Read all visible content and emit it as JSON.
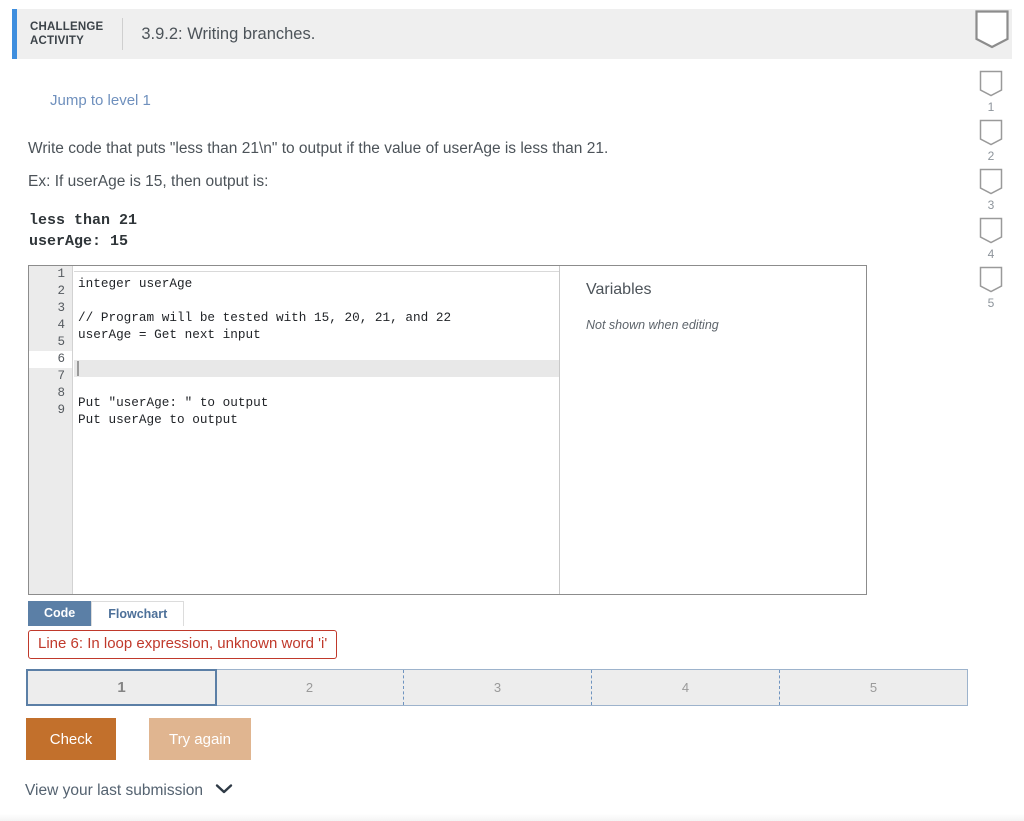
{
  "header": {
    "activity_label_line1": "CHALLENGE",
    "activity_label_line2": "ACTIVITY",
    "title": "3.9.2: Writing branches.",
    "badge_icon": "bookmark-icon"
  },
  "rail": {
    "items": [
      {
        "icon": "bookmark-icon",
        "number": "1"
      },
      {
        "icon": "bookmark-icon",
        "number": "2"
      },
      {
        "icon": "bookmark-icon",
        "number": "3"
      },
      {
        "icon": "bookmark-icon",
        "number": "4"
      },
      {
        "icon": "bookmark-icon",
        "number": "5"
      }
    ]
  },
  "content": {
    "jump_link": "Jump to level 1",
    "prompt_line1": "Write code that puts \"less than 21\\n\" to output if the value of userAge is less than 21.",
    "prompt_line2": "Ex: If userAge is 15, then output is:",
    "sample_output": "less than 21\nuserAge: 15"
  },
  "editor": {
    "line_numbers": [
      "1",
      "2",
      "3",
      "4",
      "5",
      "6",
      "7",
      "8",
      "9"
    ],
    "active_line": "6",
    "lines": [
      "integer userAge",
      "",
      "// Program will be tested with 15, 20, 21, and 22",
      "userAge = Get next input",
      "",
      "",
      "",
      "Put \"userAge: \" to output",
      "Put userAge to output"
    ],
    "variables_title": "Variables",
    "variables_note": "Not shown when editing"
  },
  "tabs": [
    {
      "label": "Code",
      "active": true
    },
    {
      "label": "Flowchart",
      "active": false
    }
  ],
  "error": {
    "message": "Line 6: In loop expression, unknown word 'i'",
    "color": "#c0392b"
  },
  "levels": {
    "current": "1",
    "segments": [
      "1",
      "2",
      "3",
      "4",
      "5"
    ]
  },
  "actions": {
    "check_label": "Check",
    "try_again_label": "Try again",
    "check_color": "#c2702c",
    "try_again_color": "#e0b590"
  },
  "footer": {
    "last_submission_label": "View your last submission",
    "chevron_icon": "chevron-down-icon"
  },
  "colors": {
    "header_accent": "#3e8ede",
    "tab_active": "#5b7fa6",
    "link": "#6f90bd"
  }
}
